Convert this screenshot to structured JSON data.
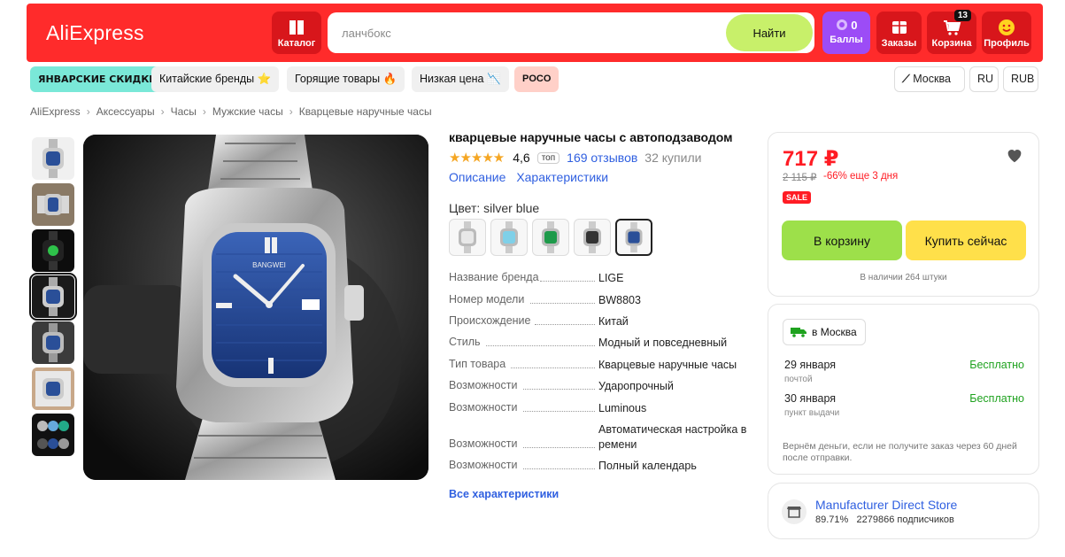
{
  "header": {
    "logo": "AliExpress",
    "catalog": "Каталог",
    "search_placeholder": "ланчбокс",
    "search_button": "Найти",
    "points_value": "0",
    "points_label": "Баллы",
    "orders": "Заказы",
    "cart": "Корзина",
    "cart_count": "13",
    "profile": "Профиль",
    "brand_color": "#ff2b2b"
  },
  "promo": {
    "items": [
      "ЯНВАРСКИЕ СКИДКИ",
      "Китайские бренды ⭐",
      "Горящие товары 🔥",
      "Низкая цена 📉",
      "POCO"
    ],
    "location": "Москва",
    "language": "RU",
    "currency": "RUB"
  },
  "breadcrumbs": [
    "AliExpress",
    "Аксессуары",
    "Часы",
    "Мужские часы",
    "Кварцевые наручные часы"
  ],
  "product": {
    "title": "кварцевые наручные часы с автоподзаводом",
    "stars": "★★★★★",
    "rating": "4,6",
    "top_badge": "топ",
    "reviews": "169 отзывов",
    "bought": "32 купили",
    "tabs": [
      "Описание",
      "Характеристики"
    ],
    "color_label": "Цвет: silver blue",
    "specs": [
      {
        "k": "Название бренда",
        "v": "LIGE"
      },
      {
        "k": "Номер модели",
        "v": "BW8803"
      },
      {
        "k": "Происхождение",
        "v": "Китай"
      },
      {
        "k": "Стиль",
        "v": "Модный и повседневный"
      },
      {
        "k": "Тип товара",
        "v": "Кварцевые наручные часы"
      },
      {
        "k": "Возможности",
        "v": "Ударопрочный"
      },
      {
        "k": "Возможности",
        "v": "Luminous"
      },
      {
        "k": "Возможности",
        "v": "Автоматическая настройка в ремени"
      },
      {
        "k": "Возможности",
        "v": "Полный календарь"
      }
    ],
    "all_specs": "Все характеристики",
    "watch_brand": "BANGWEI"
  },
  "purchase": {
    "price": "717 ₽",
    "old_price": "2 115 ₽",
    "discount": "-66% еще 3 дня",
    "sale_badge": "SALE",
    "add_to_cart": "В корзину",
    "buy_now": "Купить сейчас",
    "stock": "В наличии 264 штуки"
  },
  "delivery": {
    "city": "в Москва",
    "options": [
      {
        "date": "29 января",
        "method": "почтой",
        "price": "Бесплатно"
      },
      {
        "date": "30 января",
        "method": "пункт выдачи",
        "price": "Бесплатно"
      }
    ],
    "refund": "Вернём деньги, если не получите заказ через 60 дней после отправки."
  },
  "store": {
    "name": "Manufacturer Direct Store",
    "rating": "89.71%",
    "subscribers": "2279866 подписчиков"
  }
}
